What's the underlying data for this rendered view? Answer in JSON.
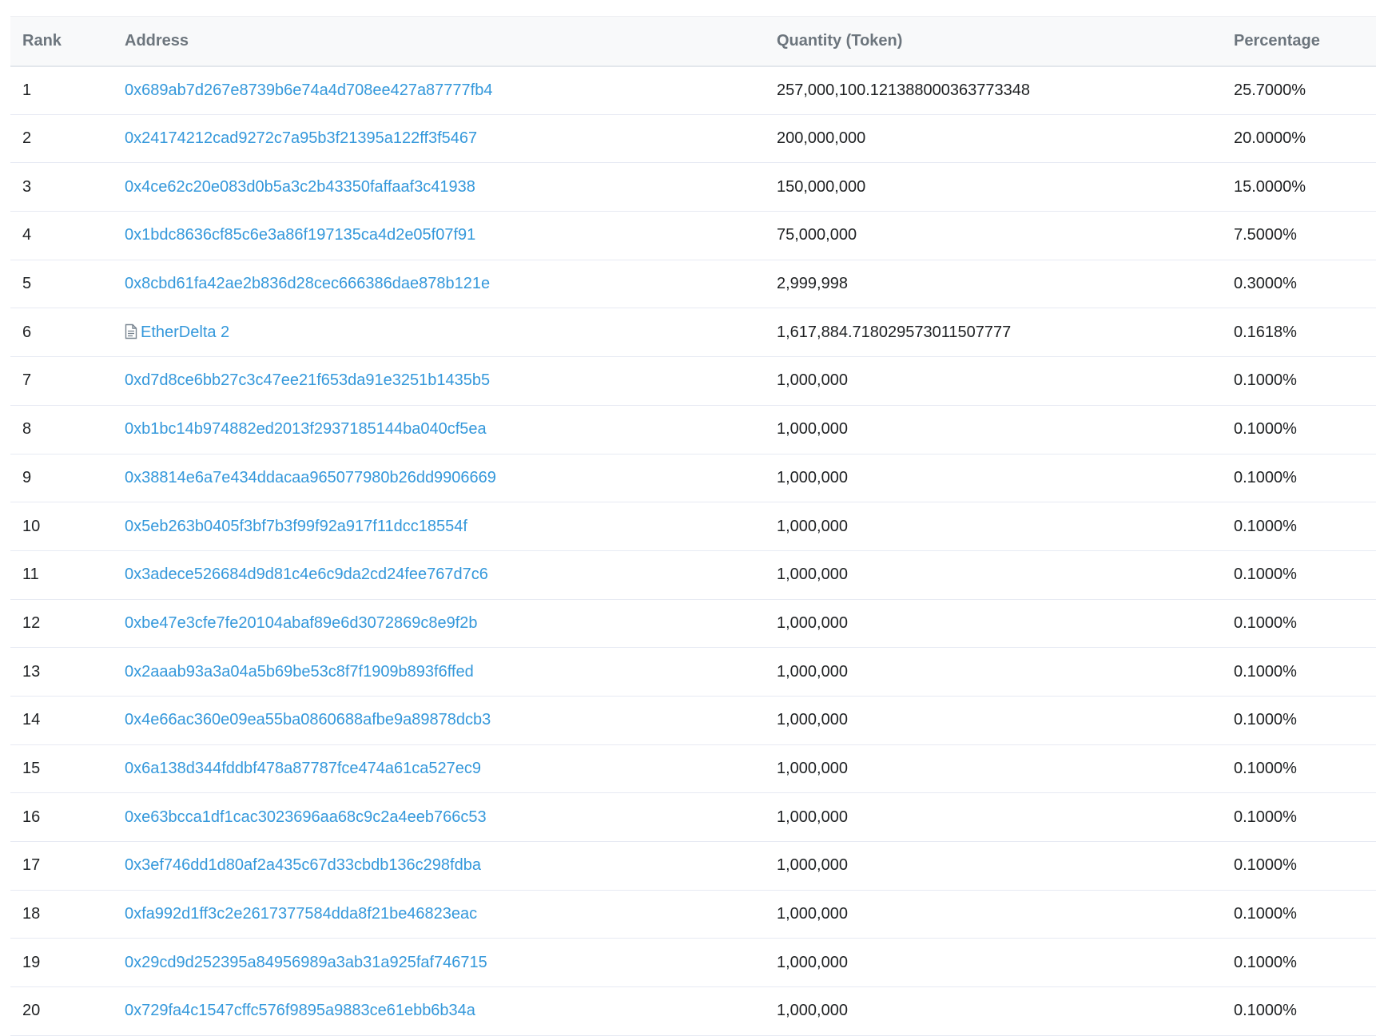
{
  "table": {
    "headers": {
      "rank": "Rank",
      "address": "Address",
      "quantity": "Quantity (Token)",
      "percentage": "Percentage"
    },
    "rows": [
      {
        "rank": "1",
        "address": "0x689ab7d267e8739b6e74a4d708ee427a87777fb4",
        "is_contract": false,
        "quantity": "257,000,100.121388000363773348",
        "percentage": "25.7000%"
      },
      {
        "rank": "2",
        "address": "0x24174212cad9272c7a95b3f21395a122ff3f5467",
        "is_contract": false,
        "quantity": "200,000,000",
        "percentage": "20.0000%"
      },
      {
        "rank": "3",
        "address": "0x4ce62c20e083d0b5a3c2b43350faffaaf3c41938",
        "is_contract": false,
        "quantity": "150,000,000",
        "percentage": "15.0000%"
      },
      {
        "rank": "4",
        "address": "0x1bdc8636cf85c6e3a86f197135ca4d2e05f07f91",
        "is_contract": false,
        "quantity": "75,000,000",
        "percentage": "7.5000%"
      },
      {
        "rank": "5",
        "address": "0x8cbd61fa42ae2b836d28cec666386dae878b121e",
        "is_contract": false,
        "quantity": "2,999,998",
        "percentage": "0.3000%"
      },
      {
        "rank": "6",
        "address": "EtherDelta 2",
        "is_contract": true,
        "icon": "contract-file-icon",
        "quantity": "1,617,884.718029573011507777",
        "percentage": "0.1618%"
      },
      {
        "rank": "7",
        "address": "0xd7d8ce6bb27c3c47ee21f653da91e3251b1435b5",
        "is_contract": false,
        "quantity": "1,000,000",
        "percentage": "0.1000%"
      },
      {
        "rank": "8",
        "address": "0xb1bc14b974882ed2013f2937185144ba040cf5ea",
        "is_contract": false,
        "quantity": "1,000,000",
        "percentage": "0.1000%"
      },
      {
        "rank": "9",
        "address": "0x38814e6a7e434ddacaa965077980b26dd9906669",
        "is_contract": false,
        "quantity": "1,000,000",
        "percentage": "0.1000%"
      },
      {
        "rank": "10",
        "address": "0x5eb263b0405f3bf7b3f99f92a917f11dcc18554f",
        "is_contract": false,
        "quantity": "1,000,000",
        "percentage": "0.1000%"
      },
      {
        "rank": "11",
        "address": "0x3adece526684d9d81c4e6c9da2cd24fee767d7c6",
        "is_contract": false,
        "quantity": "1,000,000",
        "percentage": "0.1000%"
      },
      {
        "rank": "12",
        "address": "0xbe47e3cfe7fe20104abaf89e6d3072869c8e9f2b",
        "is_contract": false,
        "quantity": "1,000,000",
        "percentage": "0.1000%"
      },
      {
        "rank": "13",
        "address": "0x2aaab93a3a04a5b69be53c8f7f1909b893f6ffed",
        "is_contract": false,
        "quantity": "1,000,000",
        "percentage": "0.1000%"
      },
      {
        "rank": "14",
        "address": "0x4e66ac360e09ea55ba0860688afbe9a89878dcb3",
        "is_contract": false,
        "quantity": "1,000,000",
        "percentage": "0.1000%"
      },
      {
        "rank": "15",
        "address": "0x6a138d344fddbf478a87787fce474a61ca527ec9",
        "is_contract": false,
        "quantity": "1,000,000",
        "percentage": "0.1000%"
      },
      {
        "rank": "16",
        "address": "0xe63bcca1df1cac3023696aa68c9c2a4eeb766c53",
        "is_contract": false,
        "quantity": "1,000,000",
        "percentage": "0.1000%"
      },
      {
        "rank": "17",
        "address": "0x3ef746dd1d80af2a435c67d33cbdb136c298fdba",
        "is_contract": false,
        "quantity": "1,000,000",
        "percentage": "0.1000%"
      },
      {
        "rank": "18",
        "address": "0xfa992d1ff3c2e2617377584dda8f21be46823eac",
        "is_contract": false,
        "quantity": "1,000,000",
        "percentage": "0.1000%"
      },
      {
        "rank": "19",
        "address": "0x29cd9d252395a84956989a3ab31a925faf746715",
        "is_contract": false,
        "quantity": "1,000,000",
        "percentage": "0.1000%"
      },
      {
        "rank": "20",
        "address": "0x729fa4c1547cffc576f9895a9883ce61ebb6b34a",
        "is_contract": false,
        "quantity": "1,000,000",
        "percentage": "0.1000%"
      }
    ]
  },
  "colors": {
    "link": "#3498db",
    "header_text": "#6c757d",
    "body_text": "#1e2022",
    "header_bg": "#f8f9fa",
    "row_border": "#e7eaf3"
  }
}
